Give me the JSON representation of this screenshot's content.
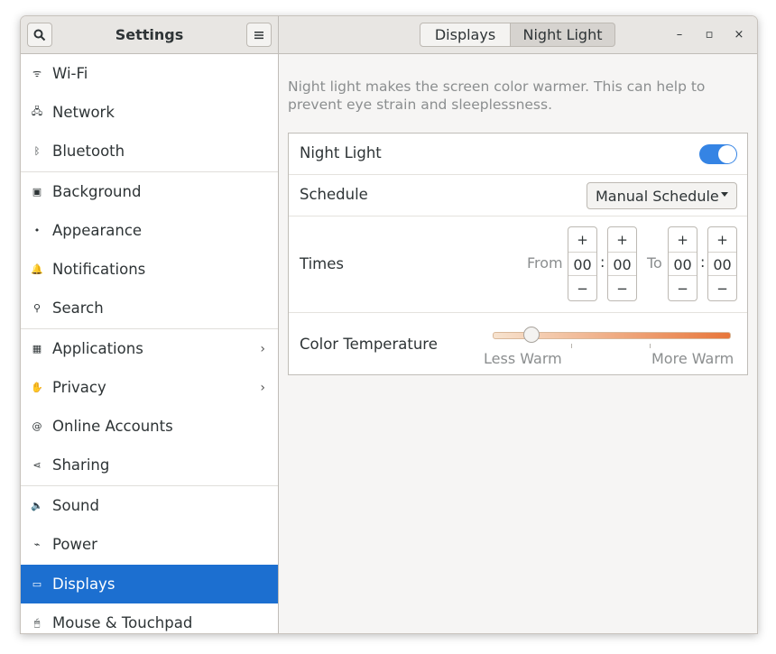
{
  "app": {
    "title": "Settings"
  },
  "header": {
    "search_icon": "search-icon",
    "menu_icon": "hamburger-menu-icon",
    "tabs": [
      {
        "label": "Displays",
        "active": false
      },
      {
        "label": "Night Light",
        "active": true
      }
    ],
    "window_controls": {
      "minimize": "–",
      "maximize": "▫",
      "close": "×"
    }
  },
  "sidebar": {
    "items": [
      {
        "label": "Wi-Fi",
        "icon": "wifi-icon",
        "glyph": "ᯤ"
      },
      {
        "label": "Network",
        "icon": "network-icon",
        "glyph": "🖧"
      },
      {
        "label": "Bluetooth",
        "icon": "bluetooth-icon",
        "glyph": "ᛒ"
      },
      {
        "label": "Background",
        "icon": "background-icon",
        "glyph": "▣"
      },
      {
        "label": "Appearance",
        "icon": "appearance-icon",
        "glyph": "•"
      },
      {
        "label": "Notifications",
        "icon": "bell-icon",
        "glyph": "🔔"
      },
      {
        "label": "Search",
        "icon": "search-icon",
        "glyph": "⚲"
      },
      {
        "label": "Applications",
        "icon": "applications-icon",
        "glyph": "▦",
        "chevron": "›"
      },
      {
        "label": "Privacy",
        "icon": "hand-icon",
        "glyph": "✋",
        "chevron": "›"
      },
      {
        "label": "Online Accounts",
        "icon": "at-icon",
        "glyph": "@"
      },
      {
        "label": "Sharing",
        "icon": "share-icon",
        "glyph": "⋖"
      },
      {
        "label": "Sound",
        "icon": "speaker-icon",
        "glyph": "🔈"
      },
      {
        "label": "Power",
        "icon": "power-icon",
        "glyph": "⌁"
      },
      {
        "label": "Displays",
        "icon": "display-icon",
        "glyph": "▭",
        "selected": true
      },
      {
        "label": "Mouse & Touchpad",
        "icon": "mouse-icon",
        "glyph": "🖱"
      }
    ]
  },
  "night_light": {
    "description": "Night light makes the screen color warmer. This can help to prevent eye strain and sleeplessness.",
    "toggle_label": "Night Light",
    "toggle_on": true,
    "schedule_label": "Schedule",
    "schedule_value": "Manual Schedule",
    "times_label": "Times",
    "from_label": "From",
    "to_label": "To",
    "from_hours": "00",
    "from_minutes": "00",
    "to_hours": "00",
    "to_minutes": "00",
    "colon": ":",
    "plus": "+",
    "minus": "−",
    "color_temp_label": "Color Temperature",
    "less_warm": "Less Warm",
    "more_warm": "More Warm",
    "slider_fraction": 0.2,
    "accent_color": "#3584e4",
    "selected_color": "#1c6fd0"
  }
}
